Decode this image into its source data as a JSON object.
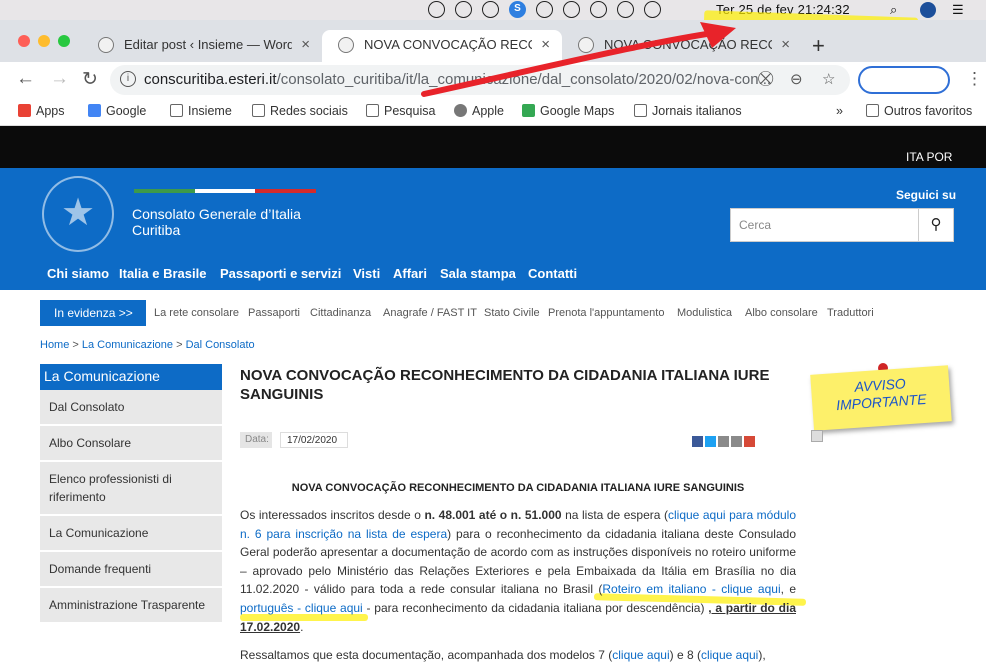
{
  "menubar": {
    "clock": "Ter 25 de fev  21:24:32",
    "search": "⌕",
    "list": "☰"
  },
  "tabs": [
    {
      "title": "Editar post ‹ Insieme — WordPre",
      "close": "×"
    },
    {
      "title": "NOVA CONVOCAÇÃO RECONHE",
      "close": "×"
    },
    {
      "title": "NOVA CONVOCAÇÃO RECONHE",
      "close": "×"
    }
  ],
  "new_tab": "+",
  "toolbar": {
    "back": "←",
    "forward": "→",
    "reload": "↻",
    "info_icon": "i",
    "url_host": "conscuritiba.esteri.it",
    "url_path": "/consolato_curitiba/it/la_comunicazione/dal_consolato/2020/02/nova-con...",
    "zoom": "⊖",
    "star": "☆",
    "menu": "⋮"
  },
  "bookmarks": [
    {
      "label": "Apps"
    },
    {
      "label": "Google"
    },
    {
      "label": "Insieme"
    },
    {
      "label": "Redes sociais"
    },
    {
      "label": "Pesquisa"
    },
    {
      "label": "Apple"
    },
    {
      "label": "Google Maps"
    },
    {
      "label": "Jornais italianos"
    },
    {
      "label": "»"
    },
    {
      "label": "Outros favoritos"
    }
  ],
  "lang": "ITA  POR",
  "site": {
    "title_line1": "Consolato Generale d’Italia",
    "title_line2": "Curitiba",
    "seguici": "Seguici su",
    "search_placeholder": "Cerca",
    "search_icon": "⚲"
  },
  "mainnav": [
    "Chi siamo",
    "Italia e Brasile",
    "Passaporti e servizi",
    "Visti",
    "Affari",
    "Sala stampa",
    "Contatti"
  ],
  "subnav": {
    "evidenza": "In evidenza >>",
    "items": [
      "La rete consolare",
      "Passaporti",
      "Cittadinanza",
      "Anagrafe / FAST IT",
      "Stato Civile",
      "Prenota l'appuntamento",
      "Modulistica",
      "Albo consolare",
      "Traduttori"
    ]
  },
  "breadcrumb": {
    "home": "Home",
    "sep": " > ",
    "section": "La Comunicazione",
    "page": "Dal Consolato"
  },
  "sidebar": {
    "heading": "La Comunicazione",
    "items": [
      "Dal Consolato",
      "Albo Consolare",
      "Elenco professionisti di riferimento",
      "La Comunicazione",
      "Domande frequenti",
      "Amministrazione Trasparente"
    ]
  },
  "article": {
    "title": "NOVA CONVOCAÇÃO RECONHECIMENTO DA CIDADANIA ITALIANA IURE SANGUINIS",
    "date_label": "Data:",
    "date": "17/02/2020",
    "subtitle": "NOVA CONVOCAÇÃO RECONHECIMENTO DA CIDADANIA ITALIANA IURE SANGUINIS",
    "p1_a": "Os interessados inscritos desde o ",
    "p1_b": "n. 48.001 até o n. 51.000",
    "p1_c": " na lista de espera (",
    "p1_link1": "clique aqui para módulo n. 6 para inscrição na lista de espera",
    "p1_d": ") para o reconhecimento da cidadania italiana deste Consulado Geral poderão apresentar a documentação de acordo com as instruções disponíveis no roteiro uniforme – aprovado pelo Ministério das Relações Exteriores e pela Embaixada da Itália em Brasília no dia 11.02.2020 - válido para toda a rede consular italiana no Brasil (",
    "p1_link2": "Roteiro em italiano - clique aqui",
    "p1_e": ", e ",
    "p1_link3": "português - clique aqui",
    "p1_f": " - para reconhecimento da cidadania italiana por descendência) ",
    "p1_g": ", a partir do dia 17.02.2020",
    "p1_h": ".",
    "p2_a": "Ressaltamos que esta documentação, acompanhada dos modelos 7 (",
    "p2_link1": "clique aqui",
    "p2_b": ") e 8 (",
    "p2_link2": "clique aqui",
    "p2_c": "),"
  },
  "avviso": {
    "line1": "AVVISO",
    "line2": "IMPORTANTE"
  },
  "colors": {
    "brand_blue": "#0d6bc6",
    "highlight": "#fff000",
    "annotation_red": "#e8232a"
  }
}
